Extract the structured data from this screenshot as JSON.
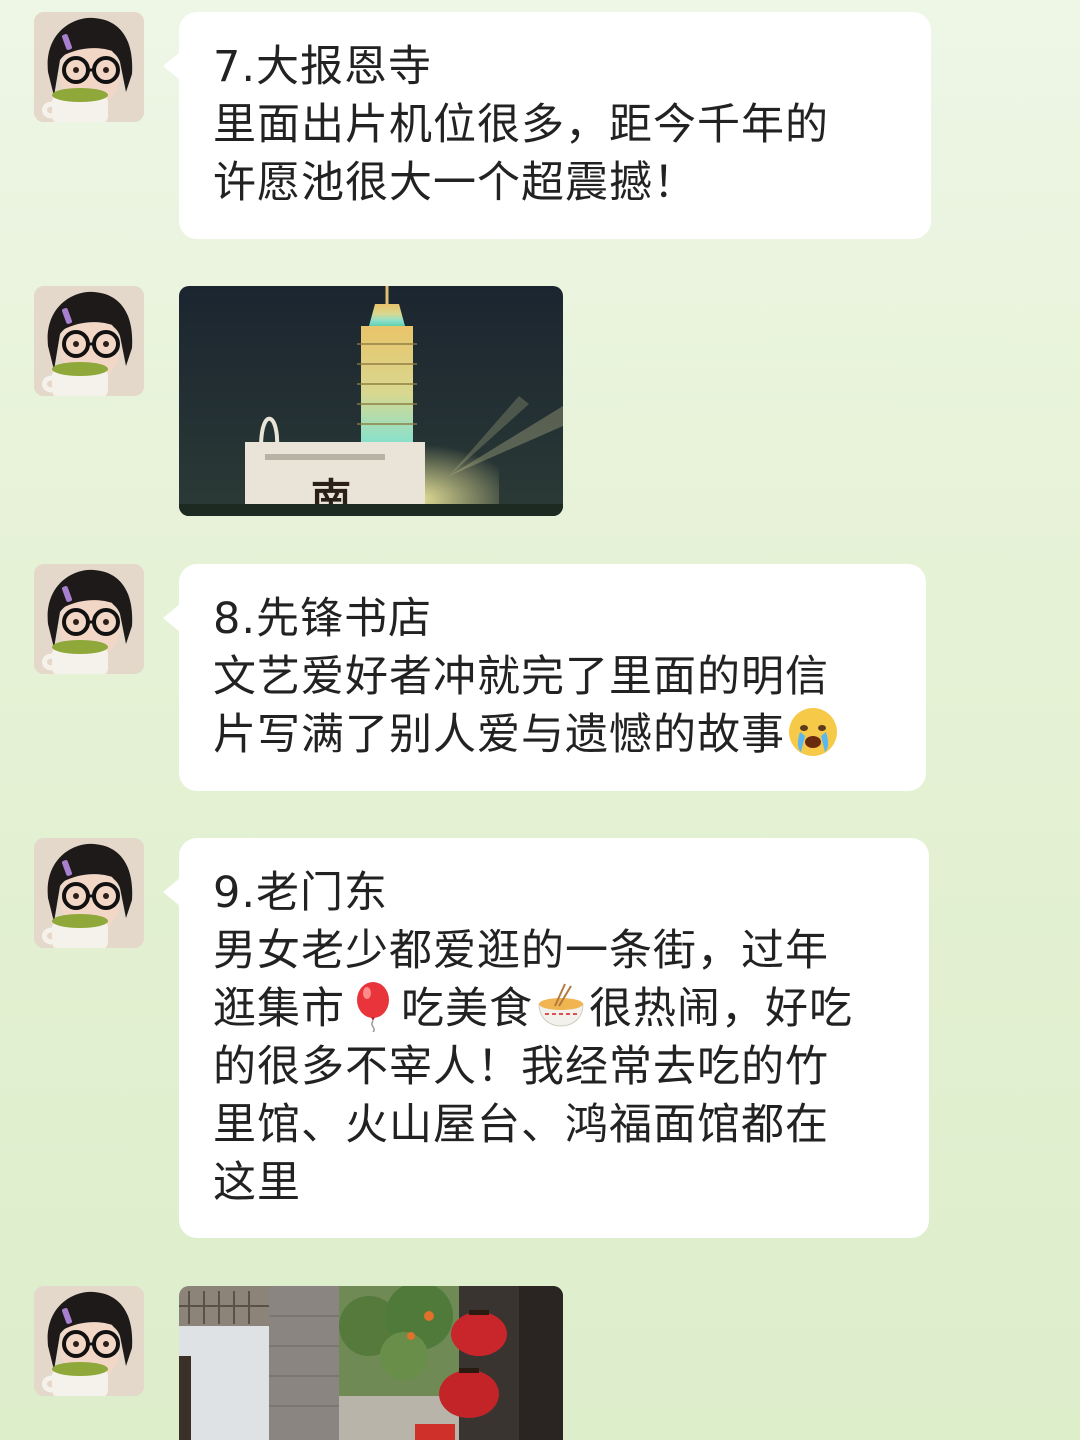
{
  "messages": [
    {
      "title": "7.大报恩寺",
      "lines": [
        "里面出片机位很多，距今千年的",
        "许愿池很大一个超震撼！"
      ]
    },
    {
      "photo": "pagoda-night-photo",
      "sign_char": "南"
    },
    {
      "title": "8.先锋书店",
      "lines": [
        "文艺爱好者冲就完了里面的明信",
        "片写满了别人爱与遗憾的故事"
      ],
      "emoji": "crying-face-emoji"
    },
    {
      "title": "9.老门东",
      "line1": "男女老少都爱逛的一条街，过年",
      "line2a": "逛集市",
      "emoji_balloon": "balloon-emoji",
      "line2b": "吃美食",
      "emoji_noodle": "noodle-bowl-emoji",
      "line2c": "很热闹，好吃",
      "line3": "的很多不宰人！我经常去吃的竹",
      "line4": "里馆、火山屋台、鸿福面馆都在",
      "line5": "这里"
    },
    {
      "photo": "old-street-lanterns-photo"
    }
  ],
  "colors": {
    "bubble": "#ffffff",
    "background": "#e6f2d6",
    "text": "#222222"
  }
}
